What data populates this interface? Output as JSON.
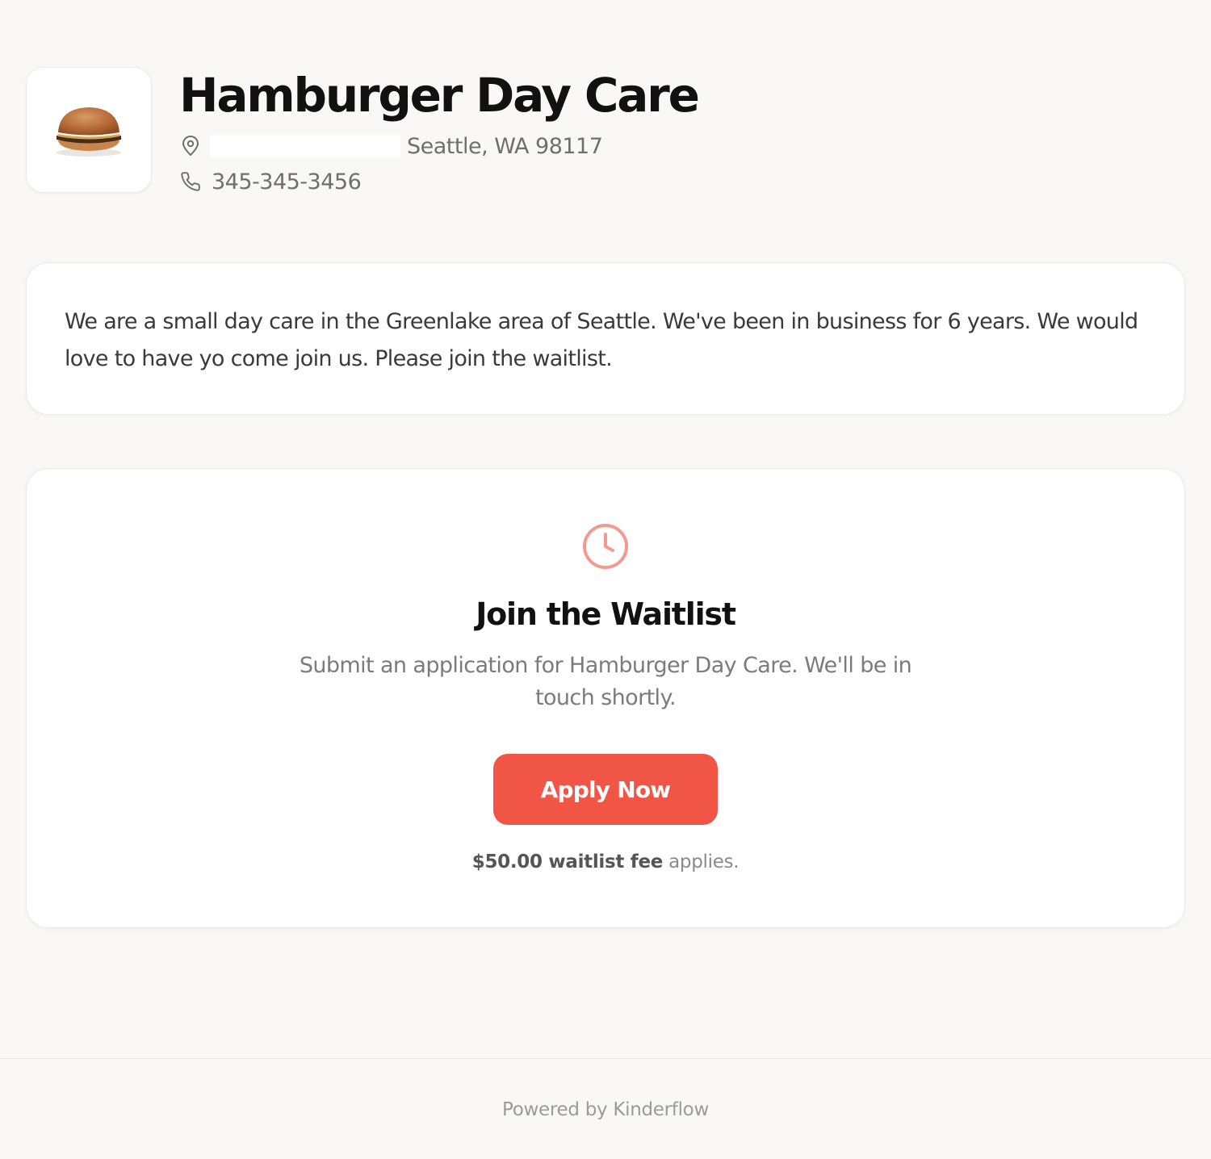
{
  "business": {
    "name": "Hamburger Day Care",
    "logo_icon": "hamburger-image",
    "address_visible": "Seattle, WA 98117",
    "phone": "345-345-3456"
  },
  "about": {
    "text": "We are a small day care in the Greenlake area of Seattle. We've been in business for 6 years. We would love to have yo come join us. Please join the waitlist."
  },
  "waitlist": {
    "icon": "clock-icon",
    "title": "Join the Waitlist",
    "subtitle": "Submit an application for Hamburger Day Care. We'll be in touch shortly.",
    "button_label": "Apply Now",
    "fee_bold": "$50.00 waitlist fee",
    "fee_rest": " applies."
  },
  "footer": {
    "text": "Powered by Kinderflow"
  },
  "colors": {
    "accent": "#f05545",
    "icon_accent": "#f29a90",
    "background": "#f9f8f7"
  }
}
